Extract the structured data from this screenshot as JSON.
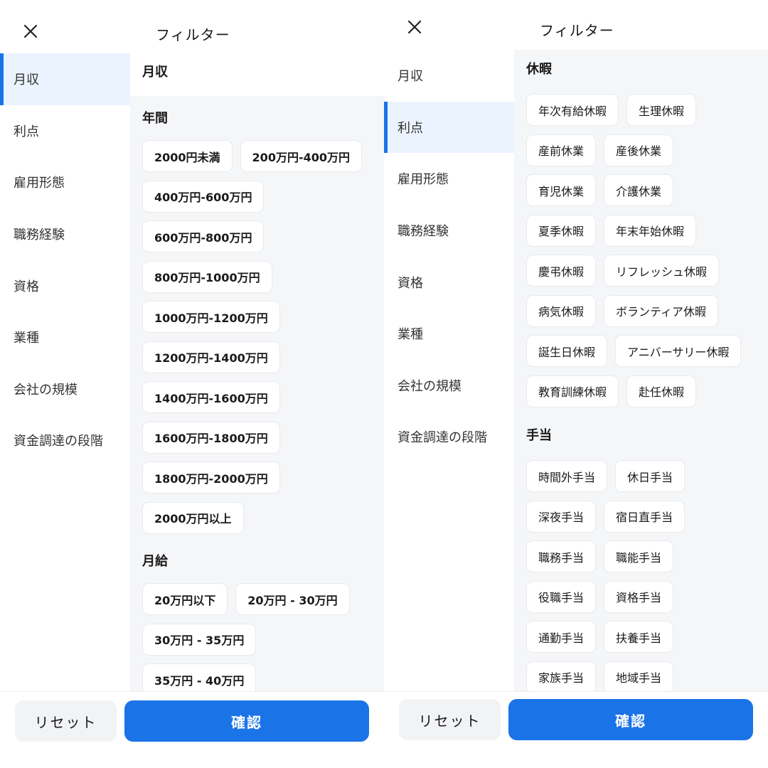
{
  "title": "フィルター",
  "icons": {
    "close": "close-icon"
  },
  "colors": {
    "accent": "#1b73e8",
    "active_bg": "#ebf3ff",
    "content_bg": "#f5f6f8"
  },
  "sidebar": [
    "月収",
    "利点",
    "雇用形態",
    "職務経験",
    "資格",
    "業種",
    "会社の規模",
    "資金調達の段階"
  ],
  "left": {
    "active_index": 0,
    "month_heading": "月収",
    "sections": [
      {
        "label": "年間",
        "chips": [
          "2000円未満",
          "200万円-400万円",
          "400万円-600万円",
          "600万円-800万円",
          "800万円-1000万円",
          "1000万円-1200万円",
          "1200万円-1400万円",
          "1400万円-1600万円",
          "1600万円-1800万円",
          "1800万円-2000万円",
          "2000万円以上"
        ]
      },
      {
        "label": "月給",
        "chips": [
          "20万円以下",
          "20万円 - 30万円",
          "30万円 - 35万円",
          "35万円 - 40万円"
        ]
      }
    ]
  },
  "right": {
    "active_index": 1,
    "sections": [
      {
        "label": "休暇",
        "chips": [
          "年次有給休暇",
          "生理休暇",
          "産前休業",
          "産後休業",
          "育児休業",
          "介護休業",
          "夏季休暇",
          "年末年始休暇",
          "慶弔休暇",
          "リフレッシュ休暇",
          "病気休暇",
          "ボランティア休暇",
          "誕生日休暇",
          "アニバーサリー休暇",
          "教育訓練休暇",
          "赴任休暇"
        ]
      },
      {
        "label": "手当",
        "chips": [
          "時間外手当",
          "休日手当",
          "深夜手当",
          "宿日直手当",
          "職務手当",
          "職能手当",
          "役職手当",
          "資格手当",
          "通勤手当",
          "扶養手当",
          "家族手当",
          "地域手当"
        ]
      }
    ]
  },
  "footer": {
    "reset": "リセット",
    "confirm": "確認"
  }
}
